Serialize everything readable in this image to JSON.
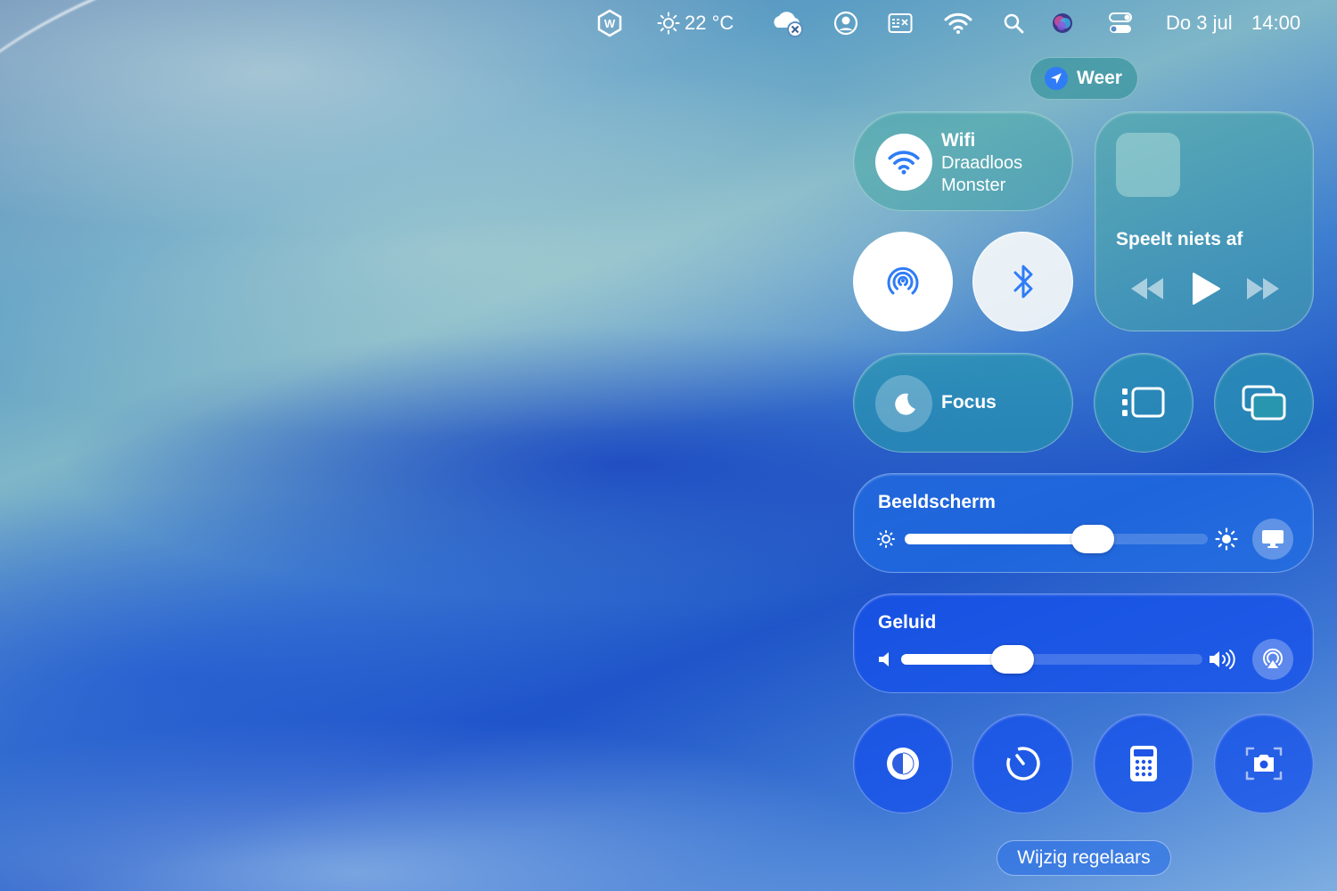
{
  "menubar": {
    "weather_temp": "22 °C",
    "date": "Do 3 jul",
    "time": "14:00",
    "icons": [
      "w-app-icon",
      "sun-icon",
      "icloud-error-icon",
      "user-icon",
      "keyboard-icon",
      "wifi-icon",
      "search-icon",
      "siri-icon",
      "control-center-icon"
    ]
  },
  "weather_pill": {
    "label": "Weer",
    "icon": "location-arrow-icon"
  },
  "wifi": {
    "title": "Wifi",
    "line1": "Draadloos",
    "line2": "Monster",
    "on": true
  },
  "airdrop": {
    "icon": "airdrop-icon",
    "on": true
  },
  "bluetooth": {
    "icon": "bluetooth-icon",
    "on": true
  },
  "media": {
    "status": "Speelt niets af",
    "controls": [
      "rewind-icon",
      "play-icon",
      "fast-forward-icon"
    ]
  },
  "focus": {
    "title": "Focus",
    "icon": "moon-icon"
  },
  "stage_manager": {
    "icon": "stage-manager-icon"
  },
  "screen_mirroring": {
    "icon": "screen-mirroring-icon"
  },
  "display": {
    "title": "Beeldscherm",
    "level": 0.62
  },
  "sound": {
    "title": "Geluid",
    "level": 0.37
  },
  "bottom_controls": [
    "dark-mode-icon",
    "timer-icon",
    "calculator-icon",
    "screenshot-icon"
  ],
  "edit_label": "Wijzig regelaars",
  "colors": {
    "accent": "#2f7cf6",
    "teal": "#46a5a5",
    "blue": "#1e6ee6"
  }
}
